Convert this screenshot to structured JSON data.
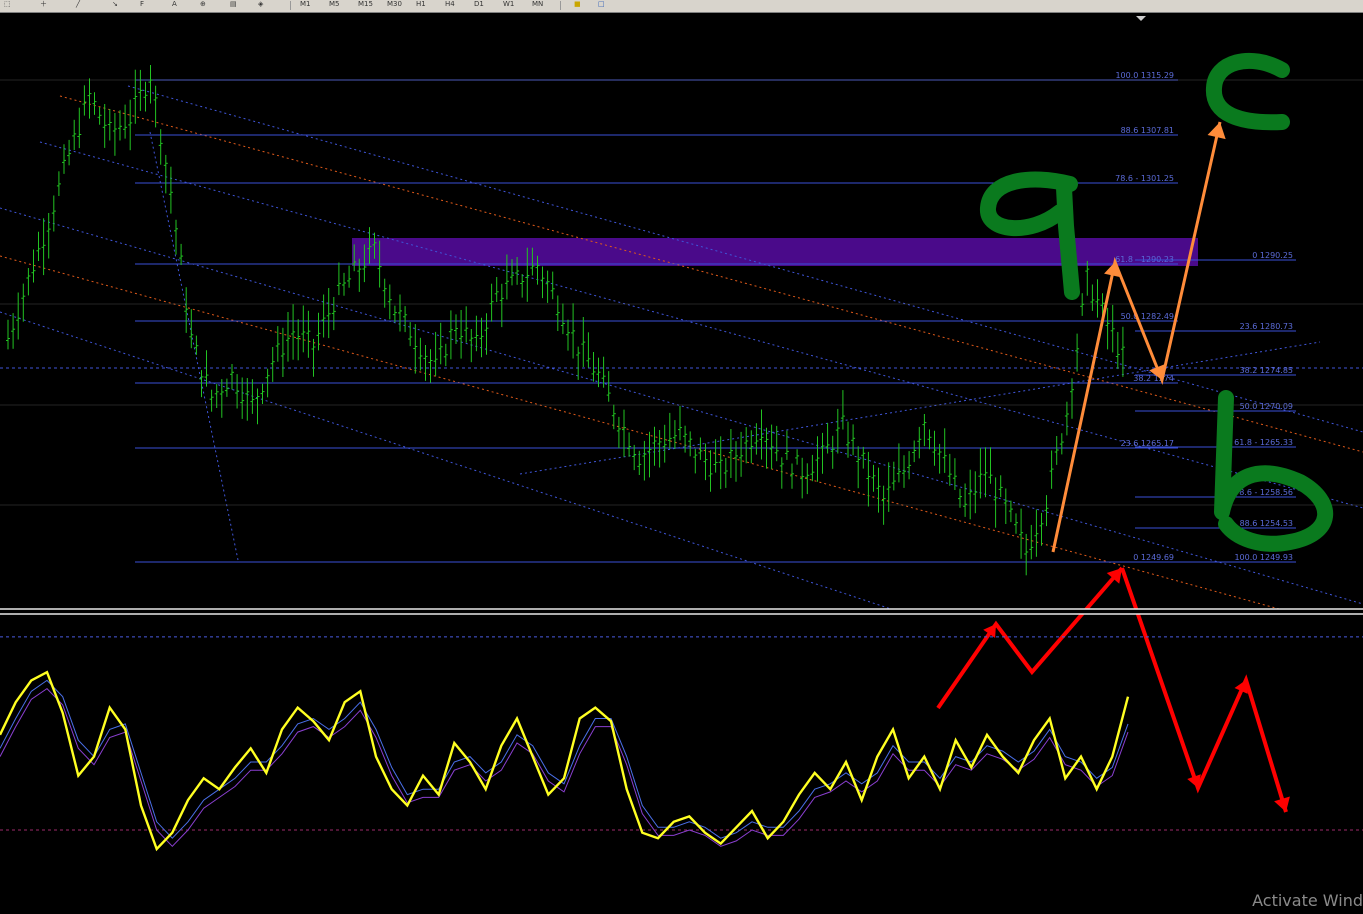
{
  "toolbar": {
    "timeframes": [
      "M1",
      "M5",
      "M15",
      "M30",
      "H1",
      "H4",
      "D1",
      "W1",
      "MN"
    ],
    "icons": [
      "cursor-icon",
      "crosshair-icon",
      "line-icon",
      "text-icon",
      "zoom-icon",
      "arrow-icon",
      "fibonacci-icon",
      "templates-icon",
      "new-order-icon"
    ]
  },
  "fib_left": {
    "labels": [
      "100.0 1315.29",
      "88.6 1307.81",
      "78.6 - 1301.25",
      "61.8 - 1290.23",
      "50.0 1282.49",
      "38.2 1274",
      "23.6 1265.17",
      "0 1249.69"
    ]
  },
  "fib_right": {
    "labels": [
      "0 1290.25",
      "23.6 1280.73",
      "38.2 1274.85",
      "50.0 1270.09",
      "61.8 - 1265.33",
      "78.6 - 1258.56",
      "88.6 1254.53",
      "100.0 1249.93"
    ]
  },
  "chart_data": [
    {
      "type": "line",
      "subtype": "candlestick-price",
      "title": "",
      "fibonacci_levels_left": [
        {
          "level": 100.0,
          "price": 1315.29
        },
        {
          "level": 88.6,
          "price": 1307.81
        },
        {
          "level": 78.6,
          "price": 1301.25
        },
        {
          "level": 61.8,
          "price": 1290.23
        },
        {
          "level": 50.0,
          "price": 1282.49
        },
        {
          "level": 38.2,
          "price": 1274
        },
        {
          "level": 23.6,
          "price": 1265.17
        },
        {
          "level": 0,
          "price": 1249.69
        }
      ],
      "fibonacci_levels_right": [
        {
          "level": 0,
          "price": 1290.25
        },
        {
          "level": 23.6,
          "price": 1280.73
        },
        {
          "level": 38.2,
          "price": 1274.85
        },
        {
          "level": 50.0,
          "price": 1270.09
        },
        {
          "level": 61.8,
          "price": 1265.33
        },
        {
          "level": 78.6,
          "price": 1258.56
        },
        {
          "level": 88.6,
          "price": 1254.53
        },
        {
          "level": 100.0,
          "price": 1249.93
        }
      ],
      "price_series": [
        1280,
        1288,
        1296,
        1305,
        1313,
        1308,
        1310,
        1316,
        1300,
        1280,
        1272,
        1275,
        1271,
        1277,
        1281,
        1279,
        1285,
        1289,
        1292,
        1284,
        1280,
        1276,
        1282,
        1279,
        1286,
        1288,
        1290,
        1285,
        1279,
        1275,
        1269,
        1264,
        1266,
        1267,
        1264,
        1262,
        1265,
        1268,
        1264,
        1262,
        1264,
        1268,
        1263,
        1258,
        1262,
        1269,
        1263,
        1257,
        1262,
        1257,
        1251,
        1258,
        1270,
        1288,
        1282,
        1276
      ],
      "annotations": [
        "a",
        "b",
        "c"
      ],
      "colors": {
        "candles": "#22c322",
        "fib_lines": "#3a4fd6",
        "fib_labels": "#5b6bd8",
        "channel_red": "#e05a1a",
        "channel_blue": "#3f55d8",
        "zone": "#4a0a8a",
        "wave_orange": "#ff8c3a",
        "wave_green": "#0a7a1e",
        "arrow_red": "#ff0000"
      }
    },
    {
      "type": "line",
      "subtype": "stochastic-oscillator",
      "series": [
        {
          "values": [
            60,
            72,
            80,
            83,
            68,
            45,
            52,
            70,
            62,
            34,
            18,
            24,
            36,
            44,
            40,
            48,
            55,
            46,
            62,
            70,
            65,
            58,
            72,
            76,
            52,
            40,
            34,
            45,
            38,
            57,
            50,
            40,
            56,
            66,
            52,
            38,
            44,
            66,
            70,
            65,
            40,
            24,
            22,
            28,
            30,
            24,
            20,
            26,
            32,
            22,
            28,
            38,
            46,
            40,
            50,
            36,
            52,
            62,
            44,
            52,
            40,
            58,
            48,
            60,
            52,
            46,
            58,
            66,
            44,
            52,
            40,
            52,
            74
          ]
        },
        {
          "values": [
            55,
            66,
            76,
            80,
            74,
            58,
            52,
            62,
            64,
            46,
            28,
            22,
            28,
            36,
            40,
            44,
            50,
            50,
            56,
            64,
            66,
            62,
            66,
            72,
            62,
            48,
            38,
            40,
            40,
            50,
            52,
            46,
            50,
            60,
            56,
            46,
            42,
            56,
            66,
            66,
            52,
            34,
            26,
            26,
            28,
            26,
            22,
            24,
            28,
            26,
            26,
            32,
            40,
            42,
            46,
            42,
            46,
            56,
            50,
            50,
            44,
            52,
            50,
            56,
            54,
            50,
            54,
            62,
            52,
            50,
            44,
            48,
            64
          ]
        }
      ]
    }
  ]
}
